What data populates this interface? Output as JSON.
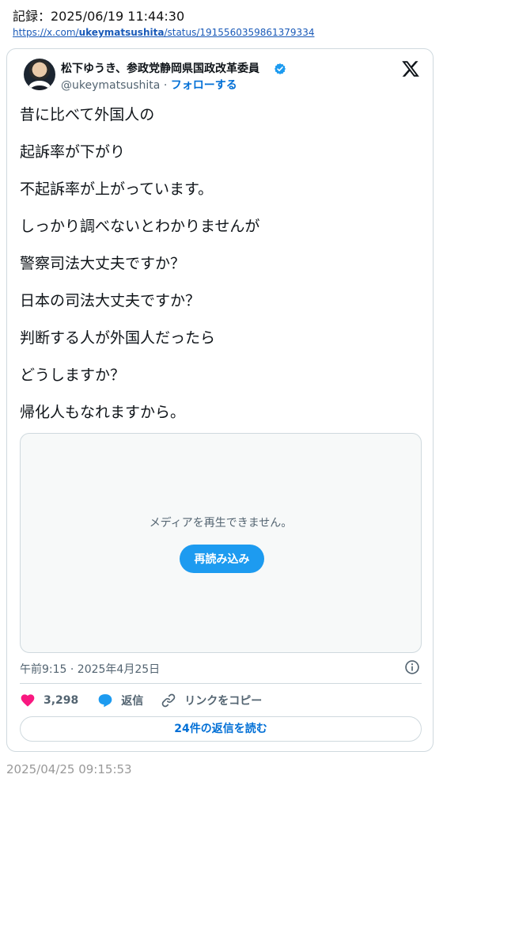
{
  "record": {
    "header": "記録：2025/06/19 11:44:30",
    "url_prefix": "https://x.com/",
    "url_user": "ukeymatsushita",
    "url_suffix": "/status/1915560359861379334"
  },
  "tweet": {
    "author_name": "松下ゆうき、参政党静岡県国政改革委員",
    "handle": "@ukeymatsushita",
    "separator": " · ",
    "follow_label": "フォローする",
    "lines": [
      "昔に比べて外国人の",
      "起訴率が下がり",
      "不起訴率が上がっています。",
      "しっかり調べないとわかりませんが",
      "警察司法大丈夫ですか？",
      "日本の司法大丈夫ですか？",
      "判断する人が外国人だったら",
      "どうしますか？",
      "帰化人もなれますから。"
    ],
    "media": {
      "message": "メディアを再生できません。",
      "reload_label": "再読み込み"
    },
    "timestamp": "午前9:15 · 2025年4月25日",
    "actions": {
      "like_count": "3,298",
      "reply_label": "返信",
      "copy_link_label": "リンクをコピー"
    },
    "read_replies_label": "24件の返信を読む"
  },
  "capture_time": "2025/04/25 09:15:53",
  "colors": {
    "accent": "#1d9bf0",
    "link": "#006fd6",
    "like": "#f91880",
    "border": "#cfd9de",
    "muted": "#536471"
  },
  "icons": [
    "verified-badge-icon",
    "x-logo-icon",
    "info-icon",
    "heart-icon",
    "reply-bubble-icon",
    "link-icon"
  ]
}
